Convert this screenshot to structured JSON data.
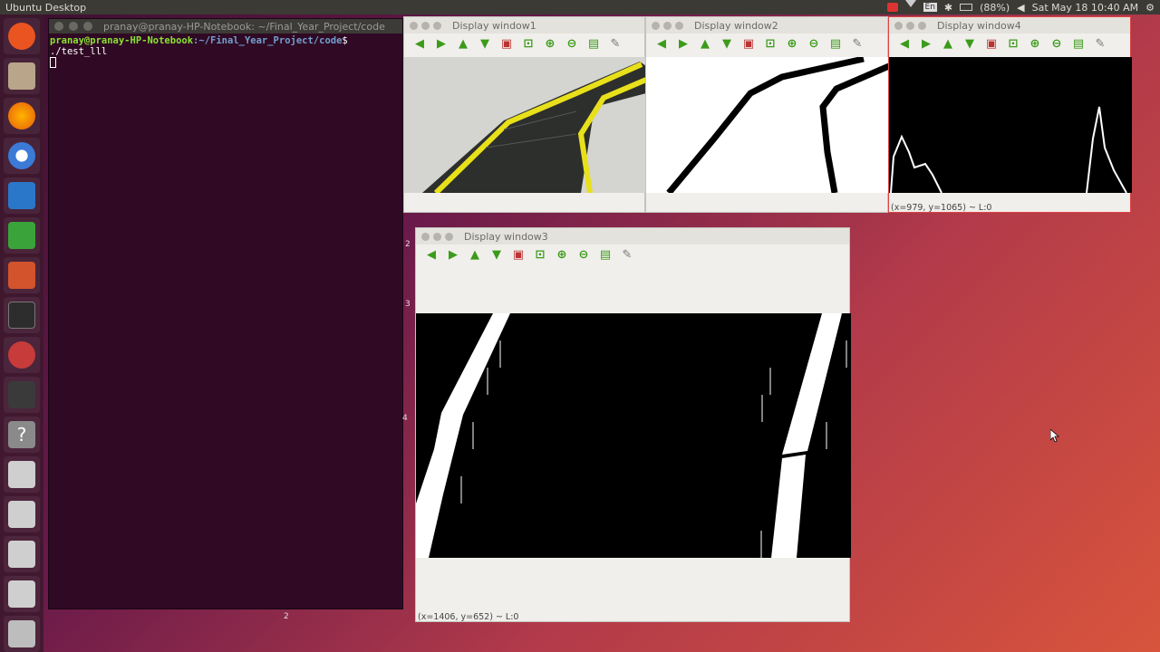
{
  "top_panel": {
    "title": "Ubuntu Desktop",
    "battery": "(88%)",
    "datetime": "Sat May 18 10:40 AM",
    "keyboard": "En"
  },
  "launcher": {
    "items": [
      "ubuntu-icon",
      "files-icon",
      "firefox-icon",
      "chromium-icon",
      "writer-icon",
      "calc-icon",
      "impress-icon",
      "terminal-icon",
      "settings-icon",
      "clapper-icon",
      "help-icon",
      "disk-icon",
      "disk-icon",
      "disk-icon",
      "disk-icon",
      "trash-icon"
    ]
  },
  "terminal": {
    "title": "pranay@pranay-HP-Notebook: ~/Final_Year_Project/code",
    "prompt_user": "pranay@pranay-HP-Notebook",
    "prompt_path": ":~/Final_Year_Project/code",
    "command": "$ ./test_lll"
  },
  "windows": {
    "w1": {
      "title": "Display window1"
    },
    "w2": {
      "title": "Display window2"
    },
    "w4": {
      "title": "Display window4",
      "status": "(x=979, y=1065) ~ L:0"
    },
    "w3": {
      "title": "Display window3",
      "status": "(x=1406, y=652) ~ L:0"
    }
  },
  "toolbar_icons": [
    "pan-left-icon",
    "pan-right-icon",
    "pan-up-icon",
    "pan-down-icon",
    "zoom-fit-icon",
    "zoom-region-icon",
    "zoom-in-icon",
    "zoom-out-icon",
    "save-icon",
    "properties-icon"
  ],
  "edge_marks": {
    "a": "2",
    "b": "3",
    "c": "4",
    "d": "2"
  }
}
